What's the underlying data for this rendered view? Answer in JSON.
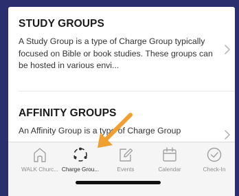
{
  "cards": [
    {
      "title": "STUDY GROUPS",
      "description": "A Study Group is a type of Charge Group typically focused on Bible or book studies. These groups can be hosted in various envi..."
    },
    {
      "title": "AFFINITY GROUPS",
      "description": "An Affinity Group is a type of Charge Group"
    }
  ],
  "tabbar": {
    "tabs": [
      {
        "label": "WALK Churc...",
        "icon": "home-icon",
        "active": false
      },
      {
        "label": "Charge Grou...",
        "icon": "charge-groups-icon",
        "active": true
      },
      {
        "label": "Events",
        "icon": "edit-icon",
        "active": false
      },
      {
        "label": "Calendar",
        "icon": "calendar-icon",
        "active": false
      },
      {
        "label": "Check-In",
        "icon": "check-circle-icon",
        "active": false
      }
    ]
  },
  "colors": {
    "background": "#2b2f6e",
    "annotation_arrow": "#f0a030",
    "inactive_icon": "#a0a0a0",
    "active_icon": "#2d2d2d"
  }
}
